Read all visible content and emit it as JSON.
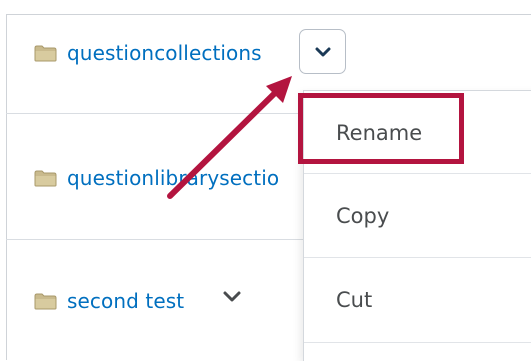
{
  "folders": [
    {
      "label": "questioncollections",
      "icon": "folder-icon"
    },
    {
      "label": "questionlibrarysectio",
      "icon": "folder-icon"
    },
    {
      "label": "second test",
      "icon": "folder-icon"
    }
  ],
  "context_menu": {
    "items": [
      "Rename",
      "Copy",
      "Cut"
    ]
  },
  "colors": {
    "link": "#006fbf",
    "highlight": "#b3143f",
    "menu_text": "#494c4e",
    "folder": "#c9ba8d"
  }
}
